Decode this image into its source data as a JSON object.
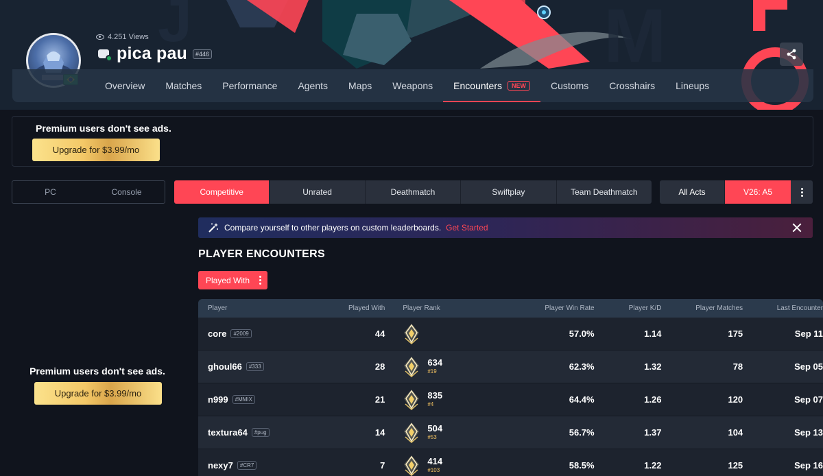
{
  "profile": {
    "views": "4.251 Views",
    "name": "pica pau",
    "tag": "#446"
  },
  "nav": {
    "items": [
      "Overview",
      "Matches",
      "Performance",
      "Agents",
      "Maps",
      "Weapons",
      "Encounters",
      "Customs",
      "Crosshairs",
      "Lineups"
    ],
    "active": "Encounters",
    "new_badge": "NEW"
  },
  "ads": {
    "top_text": "Premium users don't see ads.",
    "top_button": "Upgrade for $3.99/mo",
    "side_text": "Premium users don't see ads.",
    "side_button": "Upgrade for $3.99/mo"
  },
  "filters": {
    "platforms": [
      "PC",
      "Console"
    ],
    "modes": [
      "Competitive",
      "Unrated",
      "Deathmatch",
      "Swiftplay",
      "Team Deathmatch"
    ],
    "active_mode": "Competitive",
    "acts": [
      "All Acts",
      "V26: A5"
    ],
    "active_act": "V26: A5"
  },
  "promo": {
    "text": "Compare yourself to other players on custom leaderboards.",
    "link": "Get Started"
  },
  "section": {
    "title": "PLAYER ENCOUNTERS",
    "filter_button": "Played With"
  },
  "table": {
    "headers": [
      "Player",
      "Played With",
      "Player Rank",
      "Player Win Rate",
      "Player K/D",
      "Player Matches",
      "Last Encounter"
    ],
    "rows": [
      {
        "player": "core",
        "tag": "#2009",
        "played_with": "44",
        "rr": "",
        "pos": "",
        "win_rate": "57.0%",
        "kd": "1.14",
        "matches": "175",
        "last": "Sep 11"
      },
      {
        "player": "ghoul66",
        "tag": "#333",
        "played_with": "28",
        "rr": "634",
        "pos": "#19",
        "win_rate": "62.3%",
        "kd": "1.32",
        "matches": "78",
        "last": "Sep 05"
      },
      {
        "player": "n999",
        "tag": "#MMIX",
        "played_with": "21",
        "rr": "835",
        "pos": "#4",
        "win_rate": "64.4%",
        "kd": "1.26",
        "matches": "120",
        "last": "Sep 07"
      },
      {
        "player": "textura64",
        "tag": "#pug",
        "played_with": "14",
        "rr": "504",
        "pos": "#53",
        "win_rate": "56.7%",
        "kd": "1.37",
        "matches": "104",
        "last": "Sep 13"
      },
      {
        "player": "nexy7",
        "tag": "#CR7",
        "played_with": "7",
        "rr": "414",
        "pos": "#103",
        "win_rate": "58.5%",
        "kd": "1.22",
        "matches": "125",
        "last": "Sep 16"
      }
    ]
  },
  "colors": {
    "accent": "#ff4655",
    "background": "#10141d",
    "nav": "#263446",
    "table_header": "#2b3a4c",
    "gold": "#f3c867"
  },
  "icons": [
    "eye-icon",
    "fist-icon",
    "verified-icon",
    "share-icon",
    "magic-wand-icon",
    "close-icon",
    "more-vertical-icon",
    "radiant-rank-icon",
    "brazil-flag-icon"
  ]
}
